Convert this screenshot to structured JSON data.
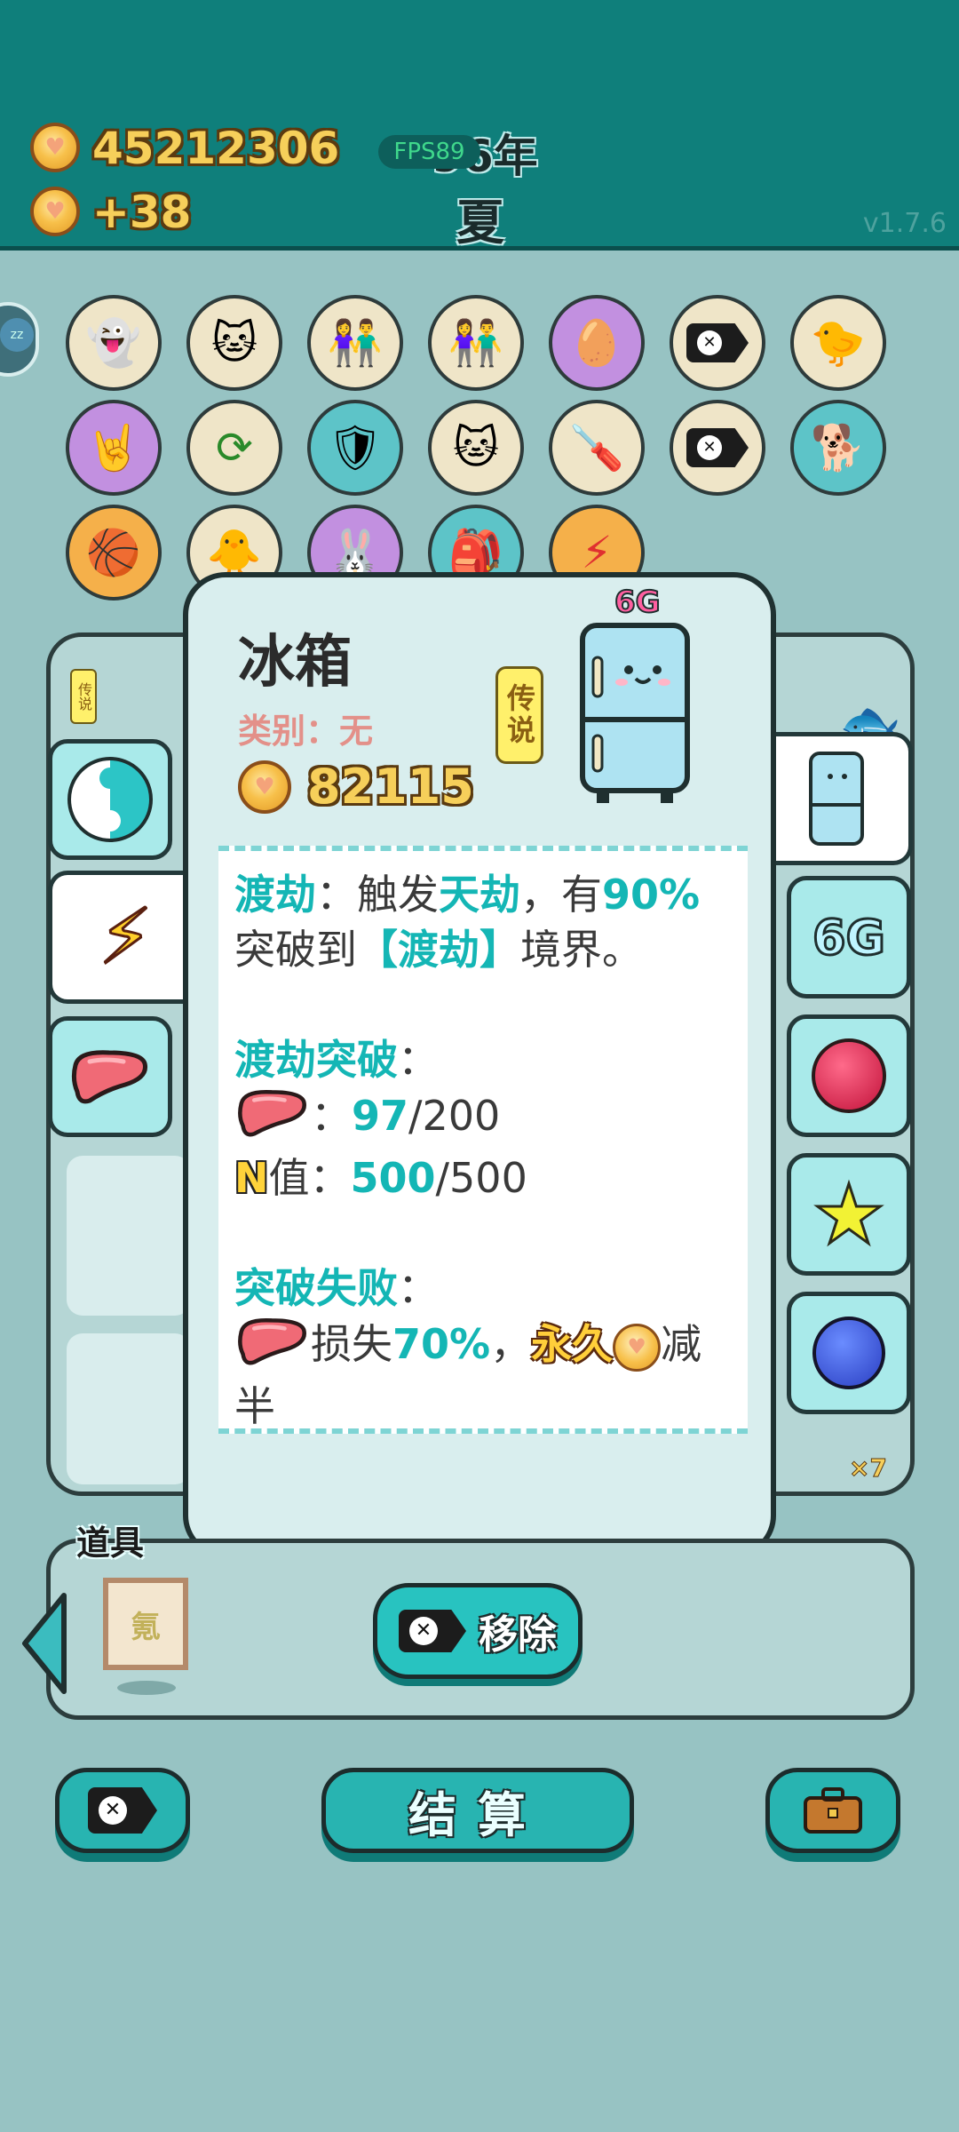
{
  "header": {
    "coins": "45212306",
    "income": "+38",
    "fps": "FPS89",
    "year": "96年",
    "season": "夏",
    "version": "v1.7.6"
  },
  "grid": {
    "icons": [
      "ghost-icon",
      "cat-icon",
      "couple-icon",
      "couple-icon",
      "egg-icon",
      "remove-tag-icon",
      "chick-egg-icon",
      "rock-hand-icon",
      "refresh-icon",
      "shield-wrench-icon",
      "cat-icon",
      "screwdriver-icon",
      "remove-tag-icon",
      "dog-icon",
      "basketball-icon",
      "chick-icon",
      "rabbit-icon",
      "bag-icon",
      "lightning-icon"
    ]
  },
  "popup": {
    "name": "冰箱",
    "category": "类别：无",
    "rarity": "传说",
    "price": "82115",
    "tag": "6G",
    "desc": {
      "l1_a": "渡劫",
      "l1_b": "：触发",
      "l1_c": "天劫",
      "l1_d": "，有",
      "l1_e": "90%",
      "l2_a": "突破到",
      "l2_b": "【渡劫】",
      "l2_c": "境界。",
      "breakthrough_title": "渡劫突破",
      "colon": "：",
      "liver_cur": "97",
      "liver_max": "/200",
      "n_letter": "N",
      "n_label": "值：",
      "n_cur": "500",
      "n_max": "/500",
      "fail_title": "突破失败",
      "fail_a": "损失",
      "fail_b": "70%",
      "fail_c": "，",
      "fail_d": "永久",
      "fail_e": "减",
      "fail_f": "半"
    }
  },
  "side_tabs": {
    "left_small_badge": "传说",
    "right_count": "×7",
    "right_tag": "6G"
  },
  "tools": {
    "label": "道具",
    "slot_text": "氪"
  },
  "buttons": {
    "remove": "移除",
    "settle": "结算"
  },
  "colors": {
    "topbar": "#0f7f7b",
    "accent": "#14b6b5",
    "gold": "#f6cf5a"
  }
}
